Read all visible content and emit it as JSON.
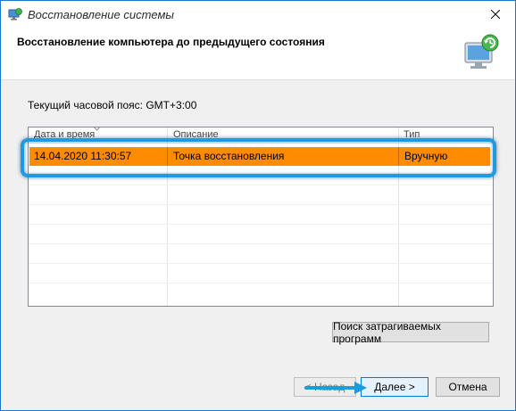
{
  "window": {
    "title": "Восстановление системы",
    "title_icon": "system-restore-icon",
    "close_icon": "close-icon"
  },
  "header": {
    "title": "Восстановление компьютера до предыдущего состояния",
    "icon": "restore-computer-icon"
  },
  "timezone_label": "Текущий часовой пояс: GMT+3:00",
  "table": {
    "columns": [
      "Дата и время",
      "Описание",
      "Тип"
    ],
    "rows": [
      {
        "date": "14.04.2020 11:30:57",
        "description": "Точка восстановления",
        "type": "Вручную",
        "selected": true
      }
    ]
  },
  "buttons": {
    "affected": "Поиск затрагиваемых программ",
    "back": "< Назад",
    "next": "Далее >",
    "cancel": "Отмена"
  },
  "colors": {
    "selection": "#ff8c00",
    "highlight": "#1e9be0",
    "accent_border": "#0078d7"
  }
}
